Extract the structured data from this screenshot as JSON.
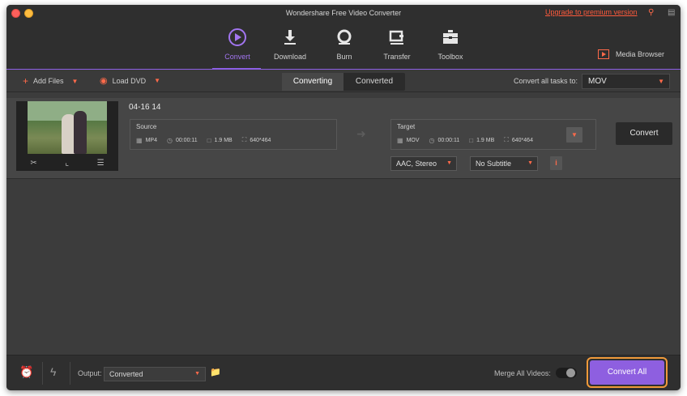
{
  "window": {
    "title": "Wondershare Free Video Converter",
    "upgrade_link": "Upgrade to premium version"
  },
  "nav": {
    "items": [
      {
        "label": "Convert",
        "icon": "convert-icon"
      },
      {
        "label": "Download",
        "icon": "download-icon"
      },
      {
        "label": "Burn",
        "icon": "burn-icon"
      },
      {
        "label": "Transfer",
        "icon": "transfer-icon"
      },
      {
        "label": "Toolbox",
        "icon": "toolbox-icon"
      }
    ],
    "active": "Convert",
    "media_browser": "Media Browser"
  },
  "toolbar": {
    "add_files": "Add Files",
    "load_dvd": "Load DVD",
    "tabs": [
      "Converting",
      "Converted"
    ],
    "active_tab": "Converting",
    "convert_all_label": "Convert all tasks to:",
    "format": "MOV"
  },
  "file": {
    "name": "04-16 14",
    "source": {
      "title": "Source",
      "format": "MP4",
      "duration": "00:00:11",
      "size": "1.9 MB",
      "resolution": "640*464"
    },
    "target": {
      "title": "Target",
      "format": "MOV",
      "duration": "00:00:11",
      "size": "1.9 MB",
      "resolution": "640*464"
    },
    "audio": "AAC, Stereo",
    "subtitle": "No Subtitle",
    "convert_button": "Convert"
  },
  "bottom": {
    "output_label": "Output:",
    "output_value": "Converted",
    "merge_label": "Merge All Videos:",
    "merge_enabled": false,
    "convert_all_button": "Convert All"
  },
  "colors": {
    "accent": "#8e5fe0",
    "highlight": "#ff6a4a",
    "outline": "#f09a3a"
  }
}
